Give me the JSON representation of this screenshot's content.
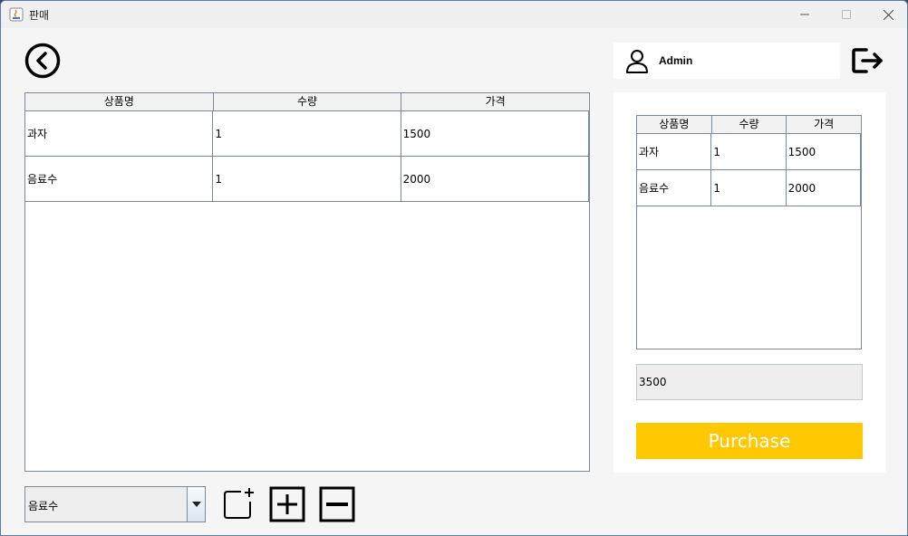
{
  "window": {
    "title": "판매"
  },
  "user": {
    "name": "Admin"
  },
  "main_table": {
    "columns": [
      "상품명",
      "수량",
      "가격"
    ],
    "rows": [
      [
        "과자",
        "1",
        "1500"
      ],
      [
        "음료수",
        "1",
        "2000"
      ]
    ]
  },
  "side_table": {
    "columns": [
      "상품명",
      "수량",
      "가격"
    ],
    "rows": [
      [
        "과자",
        "1",
        "1500"
      ],
      [
        "음료수",
        "1",
        "2000"
      ]
    ]
  },
  "total": "3500",
  "purchase_label": "Purchase",
  "product_select": {
    "selected": "음료수"
  },
  "colors": {
    "purchase": "#ffc800",
    "panel": "#ffffff",
    "background": "#f5f5f5"
  },
  "icons": [
    "java-app-icon",
    "back-icon",
    "user-icon",
    "logout-icon",
    "add-item-icon",
    "plus-icon",
    "minus-icon",
    "dropdown-arrow-icon"
  ]
}
